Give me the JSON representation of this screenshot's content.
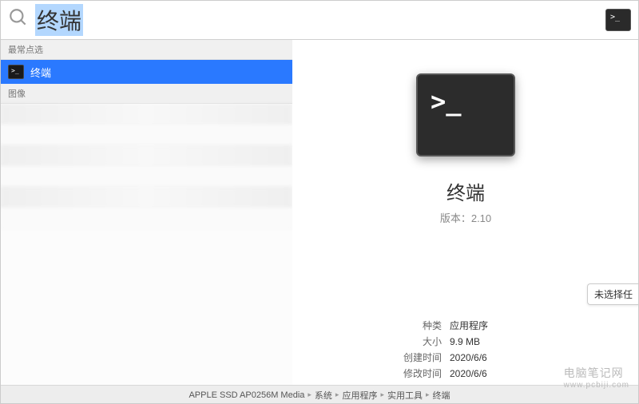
{
  "search": {
    "query": "终端"
  },
  "sections": {
    "top_hits_label": "最常点选",
    "images_label": "图像"
  },
  "results": {
    "top_hit": {
      "label": "终端"
    }
  },
  "preview": {
    "app_name": "终端",
    "version_label": "版本：",
    "version_value": "2.10",
    "tag_text": "未选择任",
    "details": [
      {
        "label": "种类",
        "value": "应用程序"
      },
      {
        "label": "大小",
        "value": "9.9 MB"
      },
      {
        "label": "创建时间",
        "value": "2020/6/6"
      },
      {
        "label": "修改时间",
        "value": "2020/6/6"
      }
    ]
  },
  "breadcrumb": [
    "APPLE SSD AP0256M Media",
    "系统",
    "应用程序",
    "实用工具",
    "终端"
  ],
  "watermark": {
    "line1": "电脑笔记网",
    "line2": "www.pcbiji.com"
  },
  "icons": {
    "terminal_prompt": ">_"
  }
}
